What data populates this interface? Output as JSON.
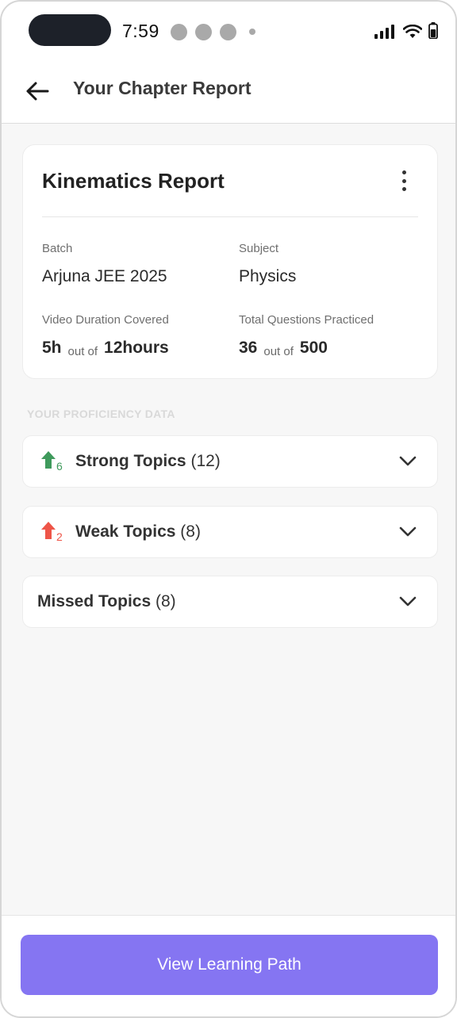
{
  "status_bar": {
    "time": "7:59",
    "icons": [
      "signal-icon",
      "wifi-icon",
      "battery-icon"
    ]
  },
  "header": {
    "title": "Your Chapter Report",
    "back_icon": "arrow-left-icon"
  },
  "report": {
    "title": "Kinematics Report",
    "batch_label": "Batch",
    "batch_value": "Arjuna JEE 2025",
    "subject_label": "Subject",
    "subject_value": "Physics",
    "video_label": "Video Duration Covered",
    "video_covered": "5h",
    "video_out_of": "out of",
    "video_total": "12hours",
    "questions_label": "Total Questions Practiced",
    "questions_done": "36",
    "questions_out_of": "out of",
    "questions_total": "500"
  },
  "proficiency": {
    "section_label": "YOUR PROFICIENCY DATA",
    "topics": [
      {
        "name": "Strong Topics",
        "count": "(12)",
        "badge": "6",
        "icon": "arrow-up-icon",
        "color": "#3f9a5c"
      },
      {
        "name": "Weak Topics",
        "count": "(8)",
        "badge": "2",
        "icon": "arrow-up-icon",
        "color": "#ee5548"
      },
      {
        "name": "Missed Topics",
        "count": "(8)"
      }
    ]
  },
  "footer": {
    "cta_label": "View Learning Path"
  },
  "colors": {
    "accent": "#8575f2",
    "strong": "#3f9a5c",
    "weak": "#ee5548"
  }
}
